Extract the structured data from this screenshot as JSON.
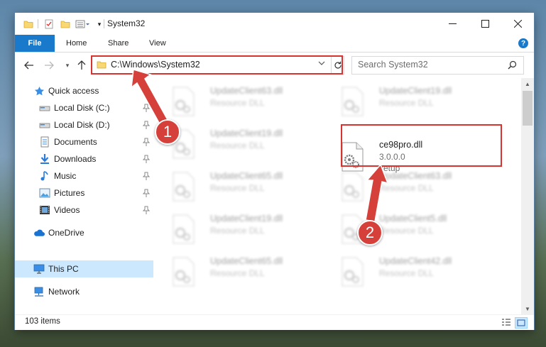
{
  "window": {
    "title": "System32",
    "quick_access_toolbar": [
      "folder-icon",
      "properties-icon",
      "new-folder-icon",
      "customize-icon"
    ],
    "controls": [
      "minimize-icon",
      "maximize-icon",
      "close-icon"
    ]
  },
  "ribbon": {
    "tabs": [
      {
        "label": "File"
      },
      {
        "label": "Home"
      },
      {
        "label": "Share"
      },
      {
        "label": "View"
      }
    ]
  },
  "address_bar": {
    "path": "C:\\Windows\\System32",
    "search_placeholder": "Search System32"
  },
  "sidebar": {
    "items": [
      {
        "label": "Quick access",
        "icon": "star-icon"
      },
      {
        "label": "Local Disk (C:)",
        "icon": "drive-icon",
        "pinned": true
      },
      {
        "label": "Local Disk (D:)",
        "icon": "drive-icon",
        "pinned": true
      },
      {
        "label": "Documents",
        "icon": "documents-icon",
        "pinned": true
      },
      {
        "label": "Downloads",
        "icon": "download-icon",
        "pinned": true
      },
      {
        "label": "Music",
        "icon": "music-icon",
        "pinned": true
      },
      {
        "label": "Pictures",
        "icon": "pictures-icon",
        "pinned": true
      },
      {
        "label": "Videos",
        "icon": "videos-icon",
        "pinned": true
      },
      {
        "label": "OneDrive",
        "icon": "cloud-icon"
      },
      {
        "label": "This PC",
        "icon": "computer-icon",
        "selected": true
      },
      {
        "label": "Network",
        "icon": "network-icon"
      }
    ]
  },
  "files": {
    "left_column": [
      {
        "name": "UpdateClient63.dll",
        "type": "Resource DLL"
      },
      {
        "name": "UpdateClient19.dll",
        "type": "Resource DLL"
      },
      {
        "name": "UpdateClient65.dll",
        "type": "Resource DLL"
      },
      {
        "name": "UpdateClient19.dll",
        "type": "Resource DLL"
      },
      {
        "name": "UpdateClient65.dll",
        "type": "Resource DLL"
      }
    ],
    "right_column": [
      {
        "name": "UpdateClient19.dll",
        "type": "Resource DLL"
      },
      {
        "name": "ce98pro.dll",
        "version": "3.0.0.0",
        "type": "setup",
        "highlighted": true
      },
      {
        "name": "UpdateClient63.dll",
        "type": "Resource DLL"
      },
      {
        "name": "UpdateClient5.dll",
        "type": "Resource DLL"
      },
      {
        "name": "UpdateClient42.dll",
        "type": "Resource DLL"
      }
    ]
  },
  "status_bar": {
    "item_count": "103 items"
  },
  "annotations": {
    "markers": [
      "1",
      "2"
    ],
    "color": "#d6403a"
  },
  "colors": {
    "accent": "#1979ca",
    "selected_bg": "#cce8ff",
    "folder": "#f8d775",
    "highlight": "#d9332f"
  }
}
